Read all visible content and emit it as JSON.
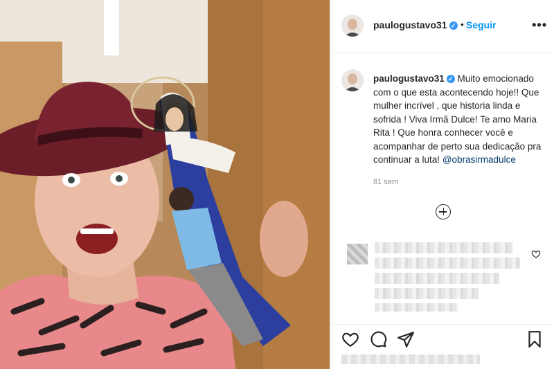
{
  "post": {
    "author": {
      "username": "paulogustavo31",
      "verified_glyph": "✓",
      "separator": "•",
      "follow_label": "Seguir",
      "more_glyph": "•••"
    },
    "caption": {
      "username": "paulogustavo31",
      "text": " Muito emocionado com o que esta acontecendo hoje!! Que mulher incrível , que historia linda e sofrida ! Viva Irmã Dulce! Te amo Maria Rita ! Que honra conhecer você e acompanhar de perto sua dedicação pra continuar a luta! ",
      "mention": "@obrasirmadulce",
      "time": "81 sem"
    },
    "icons": {
      "verified": "verified-badge-icon",
      "load_more": "plus-circle-icon",
      "comment_like": "heart-outline-icon",
      "like": "heart-icon",
      "comment": "comment-bubble-icon",
      "share": "paper-plane-icon",
      "save": "bookmark-icon",
      "more": "ellipsis-icon"
    },
    "colors": {
      "link_blue": "#0095f6",
      "verified_blue": "#3897f0",
      "mention": "#00376b",
      "text": "#262626",
      "muted": "#8e8e8e"
    }
  }
}
